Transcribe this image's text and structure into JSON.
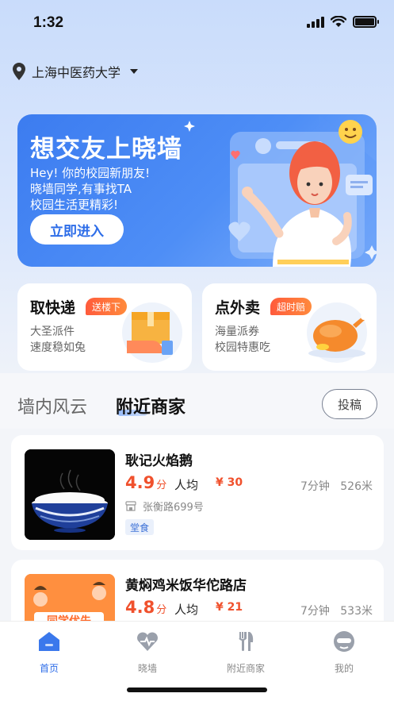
{
  "status_bar": {
    "time": "1:32"
  },
  "location": {
    "label": "上海中医药大学",
    "icon": "location-pin-icon"
  },
  "banner": {
    "title": "想交友上晓墙",
    "lines": [
      "Hey! 你的校园新朋友!",
      "晓墙同学,有事找TA",
      "校园生活更精彩!"
    ],
    "button": "立即进入"
  },
  "cards": [
    {
      "title": "取快递",
      "tag": "送楼下",
      "desc": [
        "大圣派件",
        "速度稳如兔"
      ],
      "icon": "package-hand-icon"
    },
    {
      "title": "点外卖",
      "tag": "超时赔",
      "desc": [
        "海量派券",
        "校园特惠吃"
      ],
      "icon": "roast-chicken-icon"
    }
  ],
  "tabs": [
    {
      "label": "墙内风云",
      "active": false
    },
    {
      "label": "附近商家",
      "active": true
    }
  ],
  "post_button": "投稿",
  "shops": [
    {
      "name": "耿记火焰鹅",
      "score": "4.9",
      "score_unit": "分",
      "avg_label": "人均",
      "avg_price": "¥ 30",
      "time": "7分钟",
      "distance": "526米",
      "address": "张衡路699号",
      "badge": "堂食"
    },
    {
      "name": "黄焖鸡米饭华佗路店",
      "score": "4.8",
      "score_unit": "分",
      "avg_label": "人均",
      "avg_price": "¥ 21",
      "time": "7分钟",
      "distance": "533米",
      "image_text": "同学优先"
    }
  ],
  "bottom_nav": [
    {
      "label": "首页",
      "icon": "home-icon",
      "active": true
    },
    {
      "label": "晓墙",
      "icon": "heart-icon",
      "active": false
    },
    {
      "label": "附近商家",
      "icon": "fork-knife-icon",
      "active": false
    },
    {
      "label": "我的",
      "icon": "profile-icon",
      "active": false
    }
  ],
  "colors": {
    "accent": "#2f6ee8",
    "price": "#f0512d",
    "banner": "#3c7cf0"
  }
}
